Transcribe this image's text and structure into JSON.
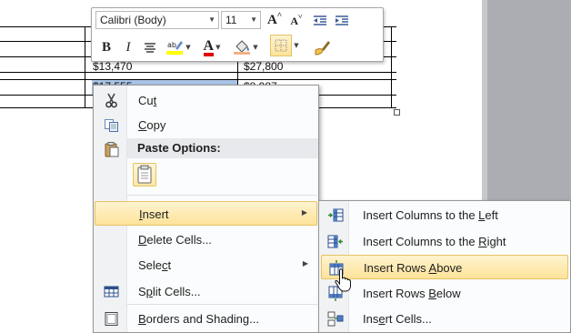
{
  "mini_toolbar": {
    "font_name": "Calibri (Body)",
    "font_size": "11",
    "grow_font": "A",
    "shrink_font": "A",
    "bold": "B",
    "italic": "I",
    "font_color": "A",
    "icons": [
      "grow-font-icon",
      "shrink-font-icon",
      "decrease-indent-icon",
      "increase-indent-icon",
      "bold-icon",
      "italic-icon",
      "center-align-icon",
      "highlight-icon",
      "font-color-icon",
      "shading-icon",
      "borders-icon",
      "format-painter-icon"
    ]
  },
  "table": {
    "cells": [
      "$13,470",
      "$27,800",
      "$17,555",
      "$8,987"
    ]
  },
  "context_menu": {
    "items": [
      {
        "pre": "Cu",
        "ul": "t",
        "post": "",
        "icon": "cut-icon"
      },
      {
        "pre": "",
        "ul": "C",
        "post": "opy",
        "icon": "copy-icon"
      },
      {
        "header": "Paste Options:",
        "icon": "paste-icon"
      },
      {
        "pre": "",
        "ul": "I",
        "post": "nsert",
        "icon": "none",
        "submenu": true
      },
      {
        "pre": "",
        "ul": "D",
        "post": "elete Cells...",
        "icon": "none"
      },
      {
        "pre": "Sele",
        "ul": "c",
        "post": "t",
        "icon": "none",
        "submenu": true
      },
      {
        "pre": "S",
        "ul": "p",
        "post": "lit Cells...",
        "icon": "split-cells-icon"
      },
      {
        "pre": "",
        "ul": "B",
        "post": "orders and Shading...",
        "icon": "borders-shading-icon"
      }
    ]
  },
  "submenu": {
    "items": [
      {
        "pre": "Insert Columns to the ",
        "ul": "L",
        "post": "eft",
        "icon": "insert-columns-left-icon"
      },
      {
        "pre": "Insert Columns to the ",
        "ul": "R",
        "post": "ight",
        "icon": "insert-columns-right-icon"
      },
      {
        "pre": "Insert Rows ",
        "ul": "A",
        "post": "bove",
        "icon": "insert-rows-above-icon",
        "highlighted": true
      },
      {
        "pre": "Insert Rows ",
        "ul": "B",
        "post": "elow",
        "icon": "insert-rows-below-icon"
      },
      {
        "pre": "Ins",
        "ul": "e",
        "post": "rt Cells...",
        "icon": "insert-cells-icon"
      }
    ]
  },
  "colors": {
    "highlight_bg": "#fde39a",
    "highlight_border": "#e5c365",
    "selection": "#a9c4e6",
    "menu_border": "#979797",
    "sidebar": "#abadb3"
  }
}
